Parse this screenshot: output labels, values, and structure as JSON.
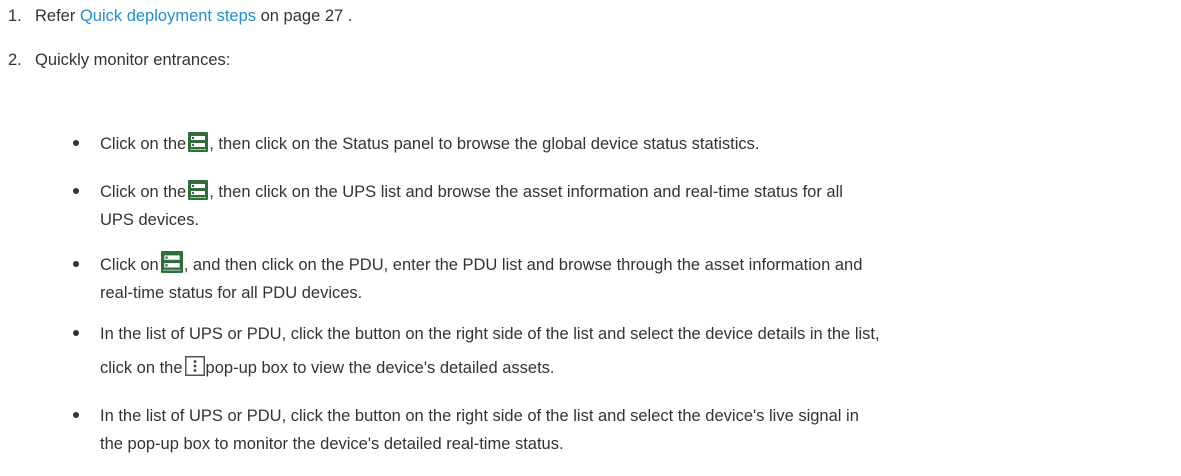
{
  "steps": [
    {
      "number": "1.",
      "prefix": "Refer ",
      "link_text": "Quick deployment steps",
      "suffix": " on page 27 ."
    },
    {
      "number": "2.",
      "text": "Quickly monitor entrances:"
    }
  ],
  "bullets": [
    {
      "before_icon": "Click on the",
      "icon": "device-list-icon",
      "after_icon": ", then click on the Status panel to browse the global device status statistics."
    },
    {
      "before_icon": "Click on the",
      "icon": "device-list-icon",
      "after_icon": ", then click on the UPS list and browse the asset information and real-time status for all",
      "line2": "UPS devices."
    },
    {
      "before_icon": "Click on",
      "icon": "device-list-icon",
      "after_icon": ", and then click on the PDU, enter the PDU list and browse through the asset information and",
      "line2": "real-time status for all PDU devices."
    },
    {
      "line1": "In the list of UPS or PDU, click the button on the right side of the list and select the device details in the list,",
      "line2_before_icon": "click on the",
      "icon": "more-options-icon",
      "line2_after_icon": "pop-up box to view the device's detailed assets."
    },
    {
      "line1": "In the list of UPS or PDU, click the button on the right side of the list and select the device's live signal in",
      "line2": "the pop-up box to monitor the device's detailed real-time status."
    }
  ],
  "colors": {
    "text": "#333333",
    "link": "#1f8fd0",
    "icon_bg": "#2e6e3a",
    "icon_fg": "#ffffff"
  }
}
